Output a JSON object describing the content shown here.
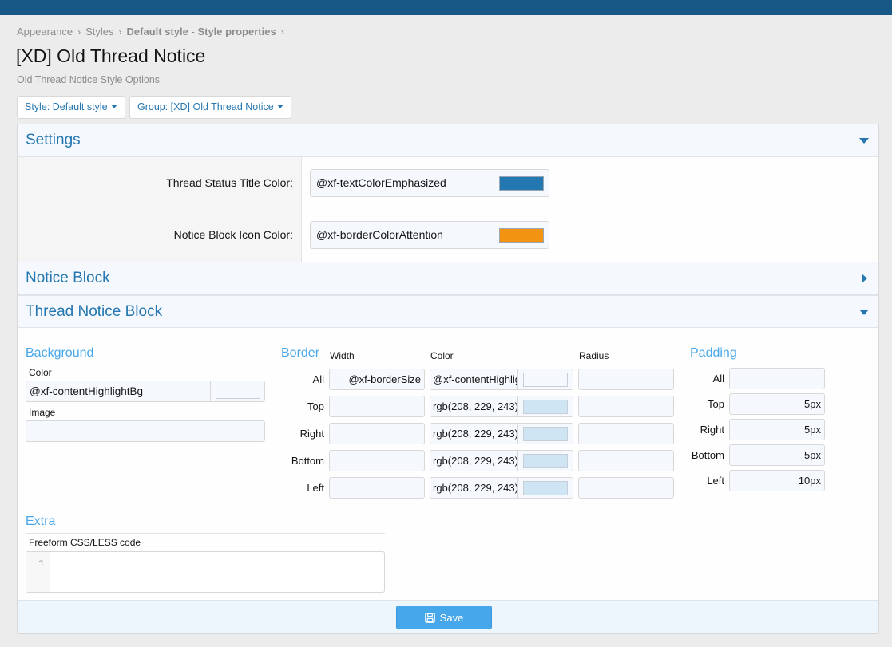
{
  "breadcrumb": {
    "items": [
      "Appearance",
      "Styles"
    ],
    "current_style": "Default style",
    "dash": "-",
    "current_page": "Style properties"
  },
  "page": {
    "title": "[XD] Old Thread Notice",
    "description": "Old Thread Notice Style Options"
  },
  "filters": {
    "style": "Style: Default style",
    "group": "Group: [XD] Old Thread Notice"
  },
  "sections": {
    "settings": "Settings",
    "notice_block": "Notice Block",
    "thread_notice_block": "Thread Notice Block"
  },
  "settings": {
    "thread_status_title_color": {
      "label": "Thread Status Title Color:",
      "value": "@xf-textColorEmphasized",
      "swatch": "#2577b1"
    },
    "notice_block_icon_color": {
      "label": "Notice Block Icon Color:",
      "value": "@xf-borderColorAttention",
      "swatch": "#f39312"
    }
  },
  "background": {
    "title": "Background",
    "color_label": "Color",
    "color_value": "@xf-contentHighlightBg",
    "color_swatch": "#f5f9fd",
    "image_label": "Image",
    "image_value": ""
  },
  "border": {
    "title": "Border",
    "col_width": "Width",
    "col_color": "Color",
    "col_radius": "Radius",
    "rows": {
      "all": {
        "label": "All",
        "width": "@xf-borderSize",
        "color": "@xf-contentHighlightBg",
        "swatch": "#f5f9fd",
        "radius": ""
      },
      "top": {
        "label": "Top",
        "width": "",
        "color": "rgb(208, 229, 243)",
        "swatch": "#d0e5f3",
        "radius": ""
      },
      "right": {
        "label": "Right",
        "width": "",
        "color": "rgb(208, 229, 243)",
        "swatch": "#d0e5f3",
        "radius": ""
      },
      "bottom": {
        "label": "Bottom",
        "width": "",
        "color": "rgb(208, 229, 243)",
        "swatch": "#d0e5f3",
        "radius": ""
      },
      "left": {
        "label": "Left",
        "width": "",
        "color": "rgb(208, 229, 243)",
        "swatch": "#d0e5f3",
        "radius": ""
      }
    }
  },
  "padding": {
    "title": "Padding",
    "rows": {
      "all": {
        "label": "All",
        "value": ""
      },
      "top": {
        "label": "Top",
        "value": "5px"
      },
      "right": {
        "label": "Right",
        "value": "5px"
      },
      "bottom": {
        "label": "Bottom",
        "value": "5px"
      },
      "left": {
        "label": "Left",
        "value": "10px"
      }
    }
  },
  "extra": {
    "title": "Extra",
    "code_label": "Freeform CSS/LESS code",
    "line_number": "1",
    "code": ""
  },
  "footer": {
    "save_label": "Save"
  },
  "colors": {
    "accent": "#2577b1",
    "subhead": "#47a7eb",
    "topbar": "#185886"
  }
}
